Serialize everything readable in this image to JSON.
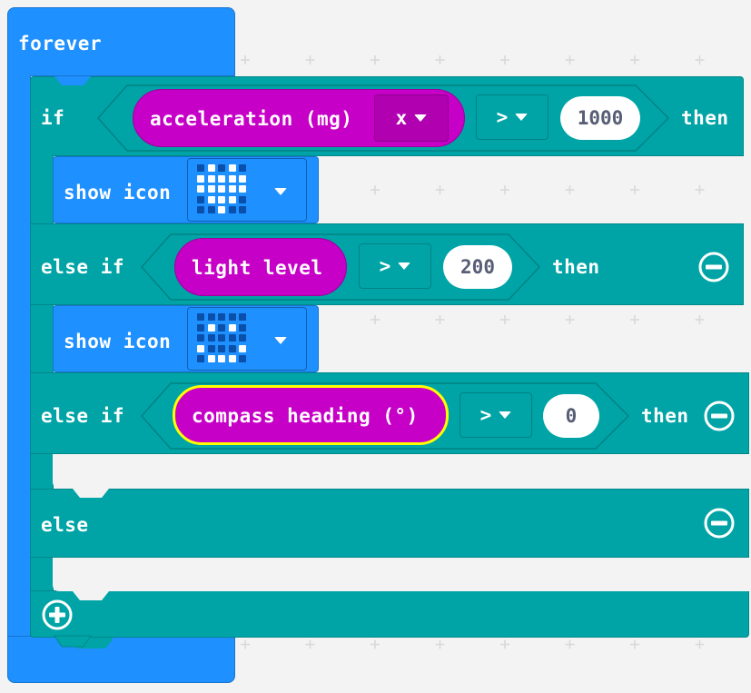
{
  "forever": {
    "label": "forever"
  },
  "if_block": {
    "if_label": "if",
    "then_label": "then",
    "condition": {
      "reporter": "acceleration (mg)",
      "axis": "x",
      "operator": ">",
      "value": "1000"
    },
    "body": {
      "action": "show icon",
      "icon": "heart-icon",
      "leds": [
        [
          0,
          1,
          0,
          1,
          0
        ],
        [
          1,
          1,
          1,
          1,
          1
        ],
        [
          1,
          1,
          1,
          1,
          1
        ],
        [
          0,
          1,
          1,
          1,
          0
        ],
        [
          0,
          0,
          1,
          0,
          0
        ]
      ]
    }
  },
  "else_if_1": {
    "label": "else if",
    "then_label": "then",
    "condition": {
      "reporter": "light level",
      "operator": ">",
      "value": "200"
    },
    "body": {
      "action": "show icon",
      "icon": "happy-face-icon",
      "leds": [
        [
          0,
          0,
          0,
          0,
          0
        ],
        [
          0,
          1,
          0,
          1,
          0
        ],
        [
          0,
          0,
          0,
          0,
          0
        ],
        [
          1,
          0,
          0,
          0,
          1
        ],
        [
          0,
          1,
          1,
          1,
          0
        ]
      ]
    }
  },
  "else_if_2": {
    "label": "else if",
    "then_label": "then",
    "condition": {
      "reporter": "compass heading (°)",
      "operator": ">",
      "value": "0"
    }
  },
  "else_block": {
    "label": "else"
  },
  "colors": {
    "forever_blue": "#1e90ff",
    "logic_teal": "#00a4a6",
    "input_purple": "#c700c7",
    "selected_outline": "#ffff00",
    "workspace_bg": "#f3f3f3"
  }
}
